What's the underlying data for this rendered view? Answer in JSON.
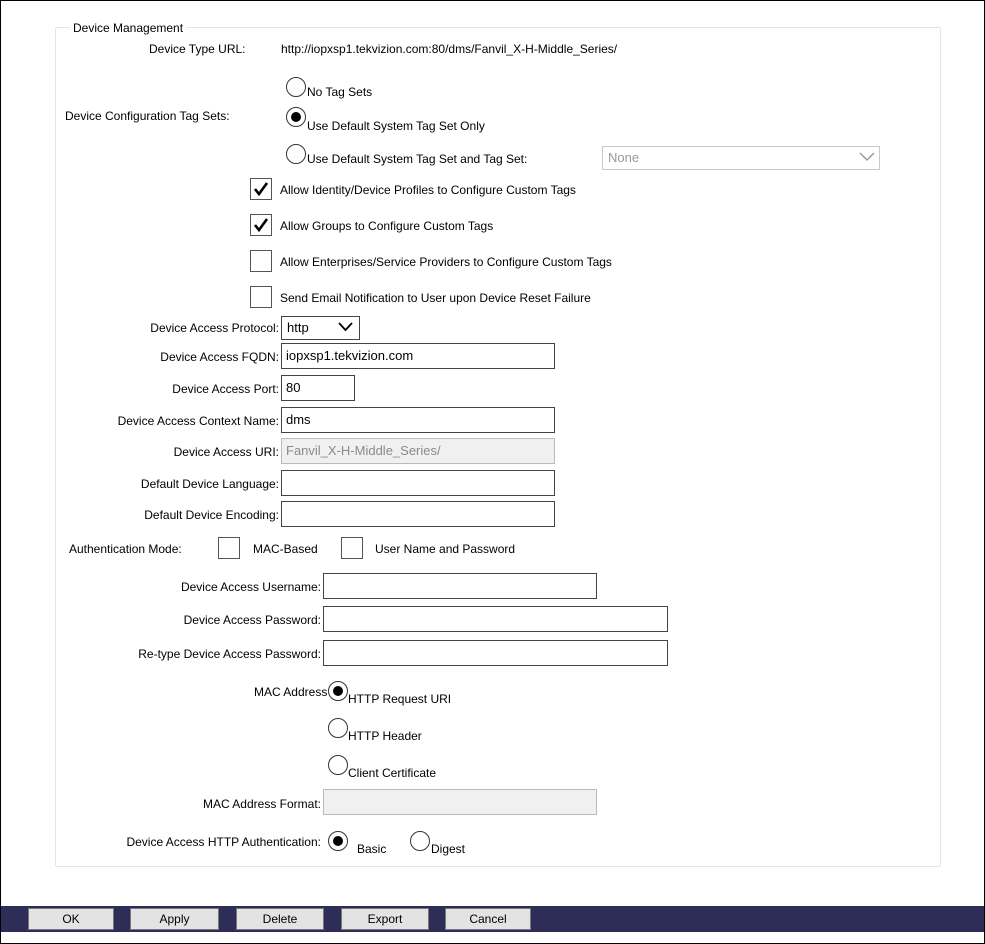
{
  "section": {
    "title": "Device Management"
  },
  "device_type_url": {
    "label": "Device Type URL:",
    "value": "http://iopxsp1.tekvizion.com:80/dms/Fanvil_X-H-Middle_Series/"
  },
  "tag_sets": {
    "label": "Device Configuration Tag Sets:",
    "options": [
      {
        "label": "No Tag Sets",
        "selected": false
      },
      {
        "label": "Use Default System Tag Set Only",
        "selected": true
      },
      {
        "label": "Use Default System Tag Set and Tag Set:",
        "selected": false
      }
    ],
    "tag_set_select": "None"
  },
  "checkboxes": [
    {
      "label": "Allow Identity/Device Profiles to Configure Custom Tags",
      "checked": true
    },
    {
      "label": "Allow Groups to Configure Custom Tags",
      "checked": true
    },
    {
      "label": "Allow Enterprises/Service Providers to Configure Custom Tags",
      "checked": false
    },
    {
      "label": "Send Email Notification to User upon Device Reset Failure",
      "checked": false
    }
  ],
  "access": {
    "protocol_label": "Device Access Protocol:",
    "protocol_value": "http",
    "fqdn_label": "Device Access FQDN:",
    "fqdn_value": "iopxsp1.tekvizion.com",
    "port_label": "Device Access Port:",
    "port_value": "80",
    "context_label": "Device Access Context Name:",
    "context_value": "dms",
    "uri_label": "Device Access URI:",
    "uri_value": "Fanvil_X-H-Middle_Series/",
    "language_label": "Default Device Language:",
    "language_value": "",
    "encoding_label": "Default Device Encoding:",
    "encoding_value": ""
  },
  "auth": {
    "label": "Authentication Mode:",
    "mac_based": "MAC-Based",
    "user_pass": "User Name and Password",
    "username_label": "Device Access Username:",
    "username_value": "",
    "password_label": "Device Access Password:",
    "password_value": "",
    "retype_label": "Re-type Device Access Password:",
    "retype_value": ""
  },
  "mac_address_in": {
    "label": "MAC Address In:",
    "options": [
      {
        "label": "HTTP Request URI",
        "selected": true
      },
      {
        "label": "HTTP Header",
        "selected": false
      },
      {
        "label": "Client Certificate",
        "selected": false
      }
    ]
  },
  "mac_format": {
    "label": "MAC Address Format:",
    "value": ""
  },
  "http_auth": {
    "label": "Device Access HTTP Authentication:",
    "basic": "Basic",
    "digest": "Digest",
    "selected": "Basic"
  },
  "buttons": {
    "ok": "OK",
    "apply": "Apply",
    "delete": "Delete",
    "export": "Export",
    "cancel": "Cancel"
  }
}
